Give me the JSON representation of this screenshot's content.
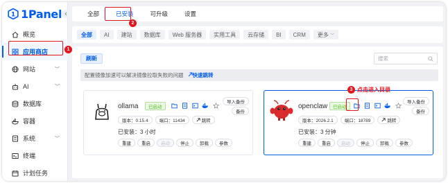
{
  "sidebar": {
    "logo_text": "1Panel",
    "collapse_icon": "chevron-left-icon",
    "items": [
      {
        "label": "概览",
        "icon": "home-icon",
        "chevron": ""
      },
      {
        "label": "应用商店",
        "icon": "grid-icon",
        "chevron": ""
      },
      {
        "label": "网站",
        "icon": "globe-icon",
        "chevron": "﹀"
      },
      {
        "label": "AI",
        "icon": "robot-icon",
        "chevron": "﹀"
      },
      {
        "label": "数据库",
        "icon": "database-icon",
        "chevron": ""
      },
      {
        "label": "容器",
        "icon": "container-icon",
        "chevron": ""
      },
      {
        "label": "系统",
        "icon": "system-icon",
        "chevron": "﹀"
      },
      {
        "label": "终端",
        "icon": "terminal-icon",
        "chevron": ""
      },
      {
        "label": "计划任务",
        "icon": "calendar-icon",
        "chevron": ""
      }
    ],
    "active_index": 1
  },
  "top_tabs": [
    "全部",
    "已安装",
    "可升级",
    "设置"
  ],
  "active_top_tab": "已安装",
  "categories": [
    "全部",
    "AI",
    "建站",
    "数据库",
    "Web 服务器",
    "实用工具",
    "云存储",
    "BI",
    "CRM",
    "更多"
  ],
  "active_category": "全部",
  "more_chevron": "﹀",
  "toolbar": {
    "sync_label": "刷新",
    "search_placeholder": "搜索"
  },
  "notice": {
    "text": "配置镜像加速可以解决镜像拉取失败的问题",
    "link": "快速跳转"
  },
  "apps": [
    {
      "name": "ollama",
      "status": "已启动",
      "version": "版本：0.15.4",
      "port": "端口：11434",
      "jump": "跳转",
      "installed": "已安装：3 小时",
      "side_buttons": [
        "导入备份",
        "备份"
      ],
      "actions": [
        "重建",
        "重启",
        "启动",
        "停止",
        "卸载",
        "参数"
      ]
    },
    {
      "name": "openclaw",
      "status": "已启动",
      "version": "版本：2026.2.1",
      "port": "端口：18789",
      "jump": "跳转",
      "installed": "已安装：3 分钟",
      "side_buttons": [
        "导入备份",
        "备份"
      ],
      "actions": [
        "重建",
        "重启",
        "启动",
        "停止",
        "卸载",
        "参数"
      ]
    }
  ],
  "annotations": {
    "badge_1": "1",
    "badge_2": "2",
    "badge_3": "3",
    "callout_3": "点击进入目录"
  },
  "colors": {
    "primary": "#005eeb",
    "annotation_red": "#e5141c",
    "running_green": "#52c41a"
  }
}
